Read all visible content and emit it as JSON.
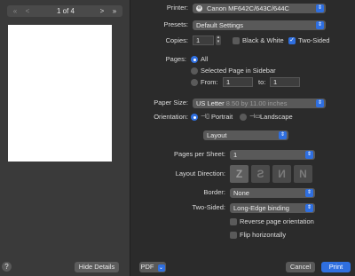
{
  "preview": {
    "page_label": "1 of 4",
    "hide_details": "Hide Details",
    "prev_first": "«",
    "prev": "<",
    "next": ">",
    "next_last": "»",
    "help": "?"
  },
  "form": {
    "printer_label": "Printer:",
    "printer_value": "Canon MF642C/643C/644C",
    "presets_label": "Presets:",
    "presets_value": "Default Settings",
    "copies_label": "Copies:",
    "copies_value": "1",
    "bw_label": "Black & White",
    "two_sided_label": "Two-Sided",
    "pages_label": "Pages:",
    "all_label": "All",
    "selected_label": "Selected Page in Sidebar",
    "from_label": "From:",
    "from_value": "1",
    "to_label": "to:",
    "to_value": "1",
    "paper_label": "Paper Size:",
    "paper_value": "US Letter",
    "paper_dims": "8.50 by 11.00 inches",
    "orientation_label": "Orientation:",
    "portrait_label": "Portrait",
    "landscape_label": "Landscape",
    "section_value": "Layout",
    "pps_label": "Pages per Sheet:",
    "pps_value": "1",
    "layout_dir_label": "Layout Direction:",
    "border_label": "Border:",
    "border_value": "None",
    "twosided_label": "Two-Sided:",
    "twosided_value": "Long-Edge binding",
    "reverse_label": "Reverse page orientation",
    "flip_label": "Flip horizontally"
  },
  "footer": {
    "pdf_label": "PDF",
    "cancel_label": "Cancel",
    "print_label": "Print"
  },
  "colors": {
    "accent": "#2f6fe0",
    "background": "#2b2b2b",
    "sidebar": "#3a3a3a"
  }
}
